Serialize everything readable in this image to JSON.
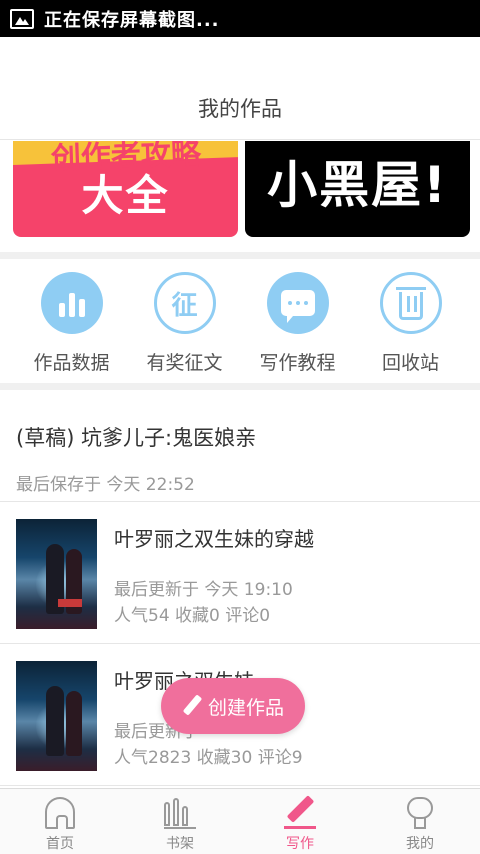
{
  "status_bar": {
    "icon": "image-icon",
    "text": "正在保存屏幕截图..."
  },
  "header": {
    "title": "我的作品"
  },
  "banners": [
    {
      "top_text": "创作者攻略",
      "main_text": "大全",
      "colors": {
        "bg": "#f5436a",
        "strip": "#f7c23a"
      }
    },
    {
      "main_text": "小黑屋!",
      "colors": {
        "bg": "#000000"
      }
    }
  ],
  "quick_actions": [
    {
      "label": "作品数据",
      "icon": "bar-chart-icon"
    },
    {
      "label": "有奖征文",
      "icon": "zheng-icon",
      "glyph": "征"
    },
    {
      "label": "写作教程",
      "icon": "chat-bubble-icon"
    },
    {
      "label": "回收站",
      "icon": "trash-icon"
    }
  ],
  "draft": {
    "title": "(草稿) 坑爹儿子:鬼医娘亲",
    "meta": "最后保存于 今天 22:52"
  },
  "works": [
    {
      "title": "叶罗丽之双生妹的穿越",
      "updated": "最后更新于 今天 19:10",
      "stats": "人气54 收藏0 评论0"
    },
    {
      "title": "叶罗丽之双生妹",
      "updated": "最后更新于",
      "stats": "人气2823 收藏30 评论9"
    }
  ],
  "fab": {
    "label": "创建作品",
    "icon": "pencil-icon",
    "color": "#f06f9c"
  },
  "tabbar": {
    "items": [
      {
        "label": "首页",
        "icon": "home-icon"
      },
      {
        "label": "书架",
        "icon": "bookshelf-icon"
      },
      {
        "label": "写作",
        "icon": "pen-icon",
        "active": true
      },
      {
        "label": "我的",
        "icon": "profile-icon"
      }
    ],
    "active_color": "#f0578a"
  },
  "colors": {
    "accent_blue": "#8fcdf3",
    "accent_pink": "#f0578a"
  }
}
